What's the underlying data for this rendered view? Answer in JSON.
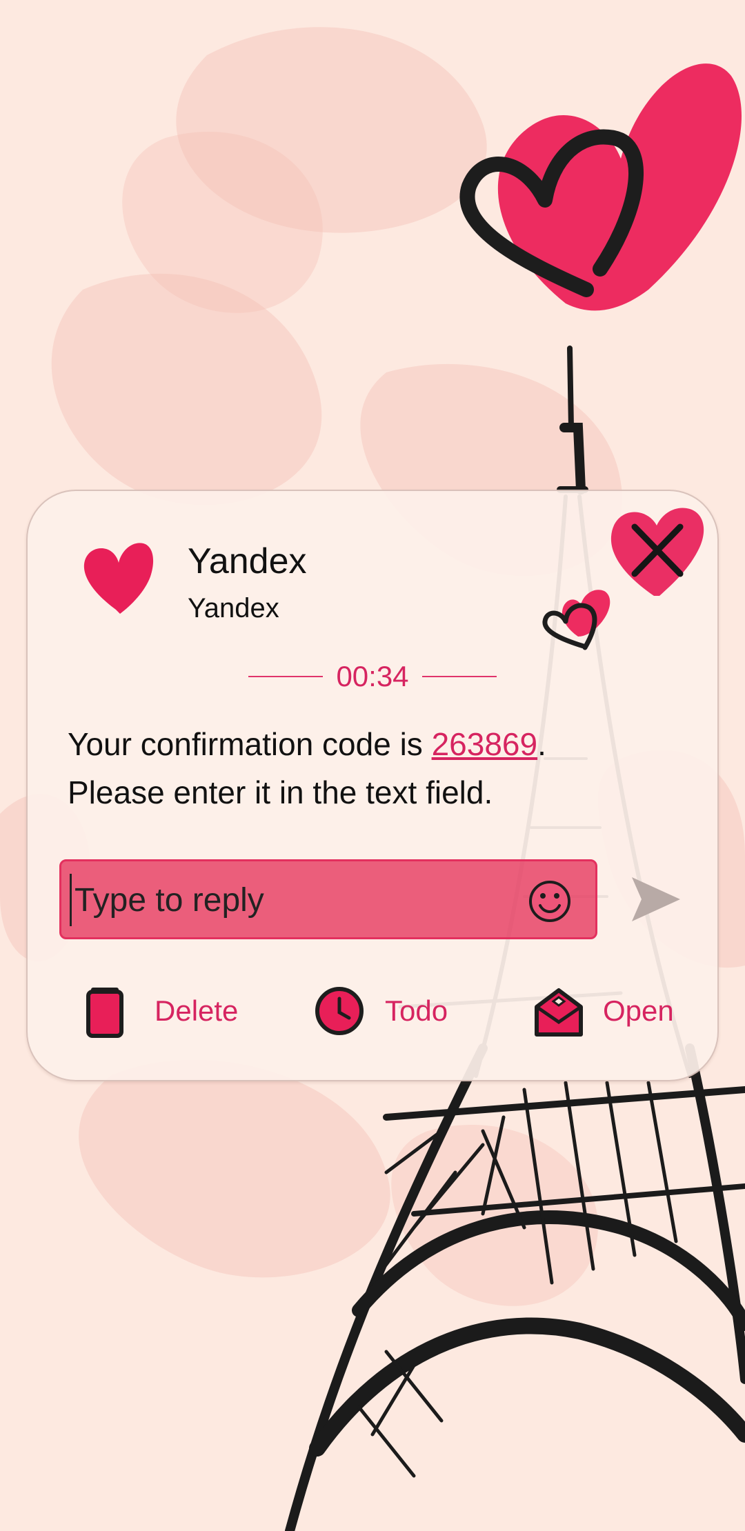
{
  "sender": {
    "name": "Yandex",
    "subtitle": "Yandex",
    "icon": "heart-icon"
  },
  "timer": "00:34",
  "message": {
    "line1_prefix": "Your confirmation code is ",
    "code": "263869",
    "line1_suffix": ".",
    "line2": "Please enter it in the text field."
  },
  "reply": {
    "placeholder": "Type to reply",
    "value": ""
  },
  "actions": [
    {
      "label": "Delete",
      "icon": "trash-icon"
    },
    {
      "label": "Todo",
      "icon": "clock-icon"
    },
    {
      "label": "Open",
      "icon": "envelope-icon"
    }
  ],
  "colors": {
    "accent": "#e0336a",
    "accent_text": "#d62460",
    "card_bg": "#fdf0ea",
    "wallpaper_bg": "#fde9e0"
  }
}
